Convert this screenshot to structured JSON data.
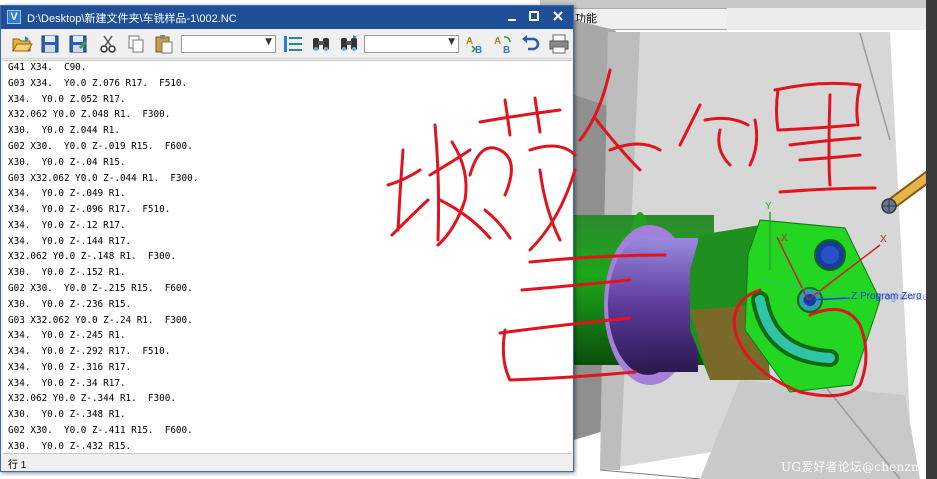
{
  "editor": {
    "title": "D:\\Desktop\\新建文件夹\\车铣样品-1\\002.NC",
    "window_controls": [
      "minimize",
      "maximize",
      "close"
    ],
    "toolbar": {
      "buttons": [
        "open",
        "save",
        "save-as",
        "cut",
        "copy",
        "paste",
        "step",
        "find",
        "find-next",
        "sort-ab",
        "replace-ab",
        "undo",
        "print"
      ],
      "select1_value": "",
      "select2_value": ""
    },
    "code_lines": [
      "G41 X34.  C90.",
      "G03 X34.  Y0.0 Z.076 R17.  F510.",
      "X34.  Y0.0 Z.052 R17.",
      "X32.062 Y0.0 Z.048 R1.  F300.",
      "X30.  Y0.0 Z.044 R1.",
      "G02 X30.  Y0.0 Z-.019 R15.  F600.",
      "X30.  Y0.0 Z-.04 R15.",
      "G03 X32.062 Y0.0 Z-.044 R1.  F300.",
      "X34.  Y0.0 Z-.049 R1.",
      "X34.  Y0.0 Z-.096 R17.  F510.",
      "X34.  Y0.0 Z-.12 R17.",
      "X34.  Y0.0 Z-.144 R17.",
      "X32.062 Y0.0 Z-.148 R1.  F300.",
      "X30.  Y0.0 Z-.152 R1.",
      "G02 X30.  Y0.0 Z-.215 R15.  F600.",
      "X30.  Y0.0 Z-.236 R15.",
      "G03 X32.062 Y0.0 Z-.24 R1.  F300.",
      "X34.  Y0.0 Z-.245 R1.",
      "X34.  Y0.0 Z-.292 R17.  F510.",
      "X34.  Y0.0 Z-.316 R17.",
      "X34.  Y0.0 Z-.34 R17.",
      "X32.062 Y0.0 Z-.344 R1.  F300.",
      "X30.  Y0.0 Z-.348 R1.",
      "G02 X30.  Y0.0 Z-.411 R15.  F600.",
      "X30.  Y0.0 Z-.432 R15."
    ],
    "status": "行 1"
  },
  "viewport": {
    "menu_fragment": "功能",
    "axis_labels": {
      "x": "X",
      "y": "Y",
      "z": "Z",
      "program_zero": "Program Zero"
    },
    "watermark": "UG爱好者论坛@chenzm",
    "colors": {
      "part_body": "#1bd41b",
      "part_dark": "#7a6a2a",
      "ring_purple": "#a57fd9",
      "tool": "#d9a23a",
      "ink": "#e0141e"
    }
  }
}
